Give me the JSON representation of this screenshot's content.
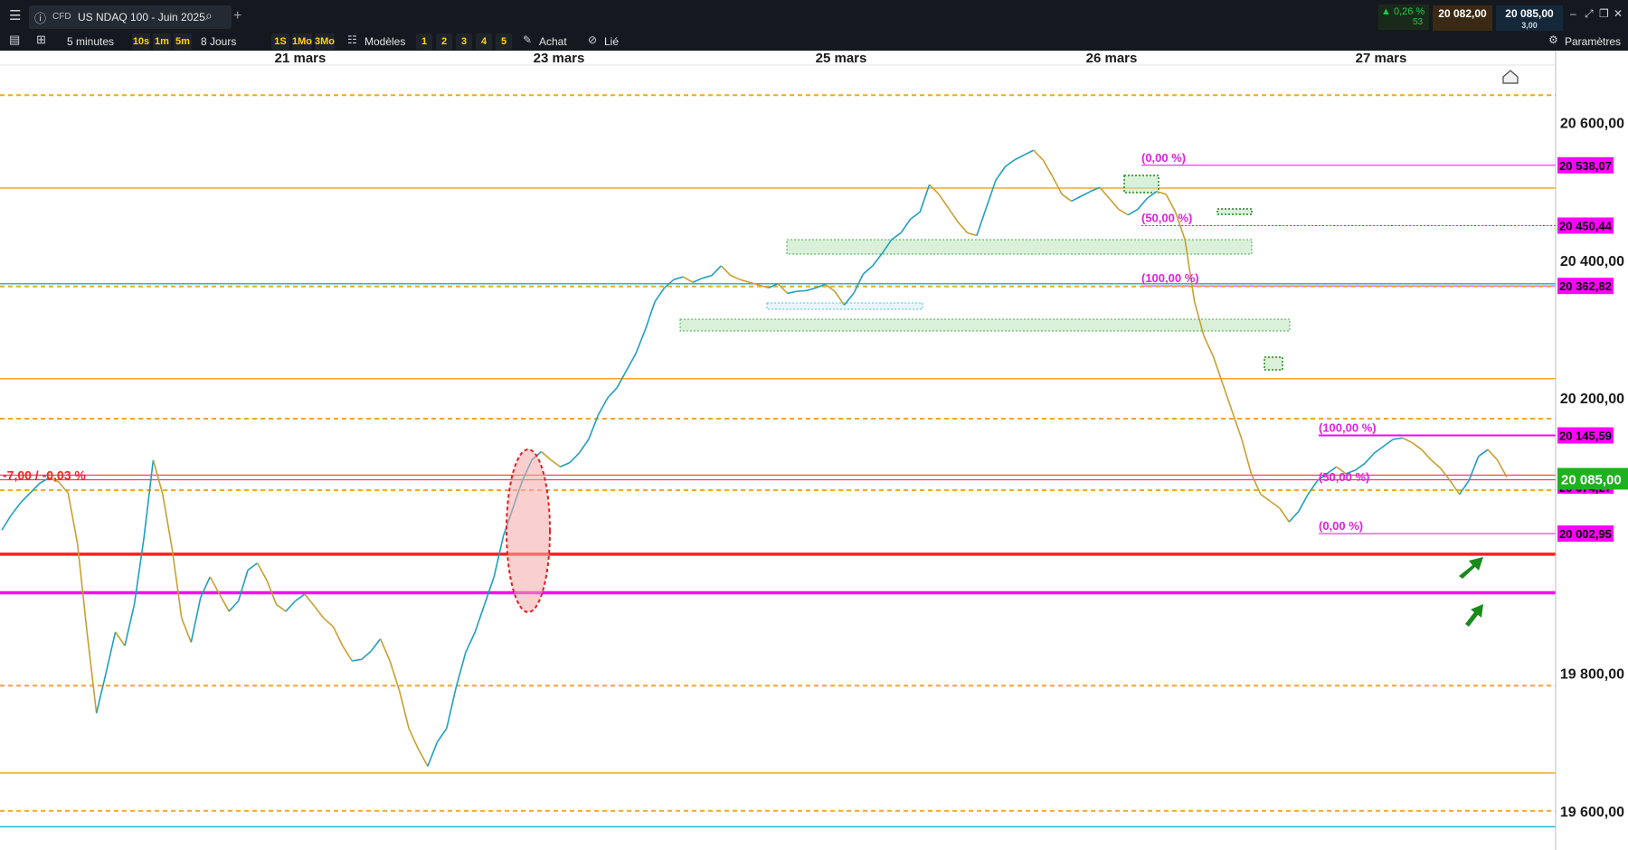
{
  "header": {
    "cfd_badge": "CFD",
    "instrument": "US NDAQ 100 - Juin 2025",
    "add_tab": "+",
    "change_pct": "▲ 0,26 %",
    "change_count": "53",
    "bid": "20 082,00",
    "ask": "20 085,00",
    "spread": "3,00"
  },
  "toolbar": {
    "timeframe": "5 minutes",
    "quick_intervals": [
      "10s",
      "1m",
      "5m"
    ],
    "range": "8 Jours",
    "quick_ranges": [
      "1S",
      "1Mo",
      "3Mo"
    ],
    "models_label": "Modèles",
    "model_slots": [
      "1",
      "2",
      "3",
      "4",
      "5"
    ],
    "buy_label": "Achat",
    "linked_label": "Lié",
    "settings_label": "Paramètres"
  },
  "colors": {
    "orange": "#f5a623",
    "pink": "#ff00ff",
    "red": "#ff2020",
    "green": "#1db31d",
    "cyan": "#24b6d8",
    "candle_up": "#1f9fbf",
    "candle_down": "#c8a030"
  },
  "chart_data": {
    "type": "line",
    "x_ticks": [
      "21 mars",
      "23 mars",
      "25 mars",
      "26 mars",
      "27 mars"
    ],
    "y_ticks": [
      "20 600,00",
      "20 400,00",
      "20 200,00",
      "19 800,00",
      "19 600,00"
    ],
    "ylim": [
      19580,
      20660
    ],
    "series": [
      {
        "values": [
          20008,
          20030,
          20048,
          20062,
          20076,
          20084,
          20078,
          20062,
          19988,
          19860,
          19742,
          19800,
          19860,
          19840,
          19900,
          19995,
          20110,
          20060,
          19980,
          19880,
          19845,
          19910,
          19940,
          19915,
          19890,
          19905,
          19950,
          19960,
          19935,
          19900,
          19890,
          19905,
          19915,
          19898,
          19880,
          19868,
          19840,
          19818,
          19820,
          19832,
          19850,
          19818,
          19775,
          19720,
          19690,
          19665,
          19700,
          19720,
          19780,
          19830,
          19860,
          19900,
          19940,
          20000,
          20040,
          20080,
          20110,
          20122,
          20110,
          20100,
          20106,
          20120,
          20140,
          20175,
          20200,
          20215,
          20240,
          20265,
          20300,
          20340,
          20360,
          20372,
          20376,
          20368,
          20374,
          20378,
          20392,
          20378,
          20372,
          20368,
          20364,
          20360,
          20366,
          20352,
          20355,
          20356,
          20360,
          20365,
          20355,
          20335,
          20352,
          20380,
          20392,
          20410,
          20430,
          20440,
          20460,
          20470,
          20510,
          20496,
          20476,
          20456,
          20440,
          20436,
          20476,
          20516,
          20536,
          20546,
          20553,
          20560,
          20546,
          20522,
          20496,
          20486,
          20493,
          20500,
          20506,
          20490,
          20474,
          20466,
          20474,
          20490,
          20500,
          20496,
          20470,
          20430,
          20340,
          20290,
          20260,
          20220,
          20180,
          20140,
          20090,
          20060,
          20050,
          20040,
          20020,
          20035,
          20060,
          20080,
          20090,
          20100,
          20090,
          20095,
          20105,
          20120,
          20130,
          20140,
          20142,
          20135,
          20125,
          20110,
          20098,
          20080,
          20060,
          20080,
          20115,
          20125,
          20110,
          20085
        ]
      }
    ],
    "horizontal_levels": [
      {
        "price": 20640,
        "color": "orange",
        "style": "dotted"
      },
      {
        "price": 20538.07,
        "color": "pink",
        "style": "thin",
        "label": "20 538,07"
      },
      {
        "price": 20505,
        "color": "orange",
        "style": "solid"
      },
      {
        "price": 20450.44,
        "color": "pink",
        "style": "dotted",
        "label": "20 450,44"
      },
      {
        "price": 20366,
        "color": "cyan",
        "style": "solid"
      },
      {
        "price": 20362.82,
        "color": "pink",
        "style": "thin",
        "label": "20 362,82"
      },
      {
        "price": 20362,
        "color": "orange",
        "style": "dotted"
      },
      {
        "price": 20228,
        "color": "orange",
        "style": "solid"
      },
      {
        "price": 20170,
        "color": "orange",
        "style": "dotted"
      },
      {
        "price": 20145.59,
        "color": "pink",
        "style": "solid",
        "label": "20 145,59"
      },
      {
        "price": 20088,
        "color": "red",
        "style": "thin"
      },
      {
        "price": 20081,
        "color": "red",
        "style": "thin"
      },
      {
        "price": 20066,
        "color": "orange",
        "style": "dotted"
      },
      {
        "price": 20002.95,
        "color": "pink",
        "style": "thin",
        "label": "20 002,95"
      },
      {
        "price": 19973,
        "color": "red",
        "style": "bold"
      },
      {
        "price": 19917,
        "color": "pink",
        "style": "bold"
      },
      {
        "price": 19782,
        "color": "orange",
        "style": "dotted"
      },
      {
        "price": 19655,
        "color": "orange",
        "style": "solid"
      },
      {
        "price": 19600,
        "color": "orange",
        "style": "dotted"
      },
      {
        "price": 19577,
        "color": "cyan",
        "style": "solid"
      }
    ],
    "fib_labels": [
      {
        "text": "(0,00 %)",
        "price": 20538.07
      },
      {
        "text": "(50,00 %)",
        "price": 20450.44
      },
      {
        "text": "(100,00 %)",
        "price": 20362.82
      },
      {
        "text": "(100,00 %)",
        "price": 20145.59
      },
      {
        "text": "(50,00 %)",
        "price": 20074
      },
      {
        "text": "(0,00 %)",
        "price": 20002.95
      }
    ],
    "current_price_label": "20 085,00",
    "hidden_tag_label": "20 074,27",
    "change_annotation": "-7,00 / -0,03 %"
  }
}
